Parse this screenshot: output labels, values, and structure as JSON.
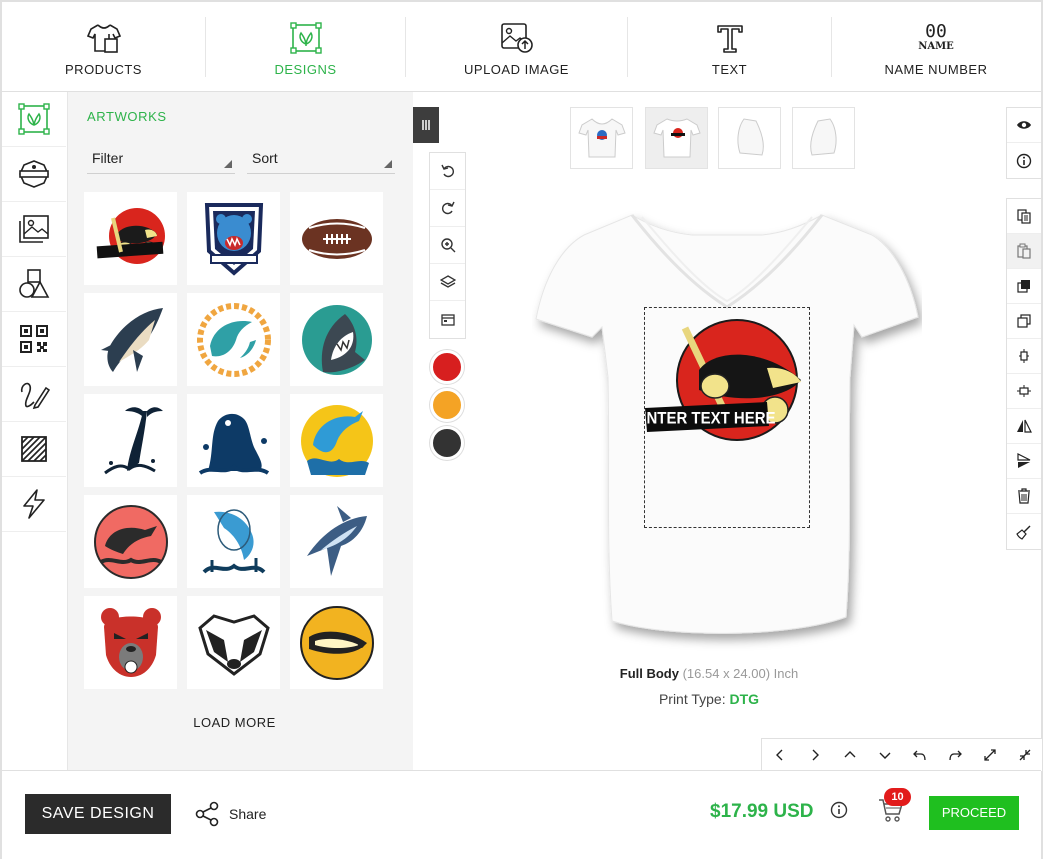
{
  "topnav": {
    "items": [
      {
        "label": "PRODUCTS",
        "icon": "tshirt-icon"
      },
      {
        "label": "DESIGNS",
        "icon": "designs-icon",
        "active": true
      },
      {
        "label": "UPLOAD IMAGE",
        "icon": "upload-image-icon"
      },
      {
        "label": "TEXT",
        "icon": "text-icon"
      },
      {
        "label": "NAME NUMBER",
        "icon": "name-number-icon",
        "icon_text": "00",
        "icon_subtext": "NAME"
      }
    ]
  },
  "rail": {
    "items": [
      "designs-icon",
      "badge-template-icon",
      "image-gallery-icon",
      "shapes-icon",
      "qr-code-icon",
      "draw-icon",
      "pattern-icon",
      "quick-effects-icon"
    ]
  },
  "panel": {
    "title": "ARTWORKS",
    "filter_label": "Filter",
    "sort_label": "Sort",
    "load_more": "LOAD MORE",
    "artworks": [
      "badger-hockey",
      "bear-shield",
      "football",
      "shark-1",
      "dolphin-sun",
      "shark-circle",
      "whale-tail",
      "fish-splash",
      "dolphin-yellow",
      "dolphin-red",
      "dolphin-jump",
      "shark-blue",
      "bear-red",
      "badger-bw",
      "badger-yellow"
    ]
  },
  "canvas": {
    "design_text": "ENTER TEXT HERE",
    "area_name": "Full Body",
    "area_size": "(16.54 x 24.00) Inch",
    "print_type_label": "Print Type:",
    "print_type_value": "DTG"
  },
  "colors": {
    "swatches": [
      "#d71f1f",
      "#f4a325",
      "#333333"
    ],
    "accent": "#2db34a",
    "proceed": "#1fbf1f"
  },
  "footer": {
    "save_label": "SAVE DESIGN",
    "share_label": "Share",
    "price": "$17.99 USD",
    "cart_count": "10",
    "proceed_label": "PROCEED"
  }
}
